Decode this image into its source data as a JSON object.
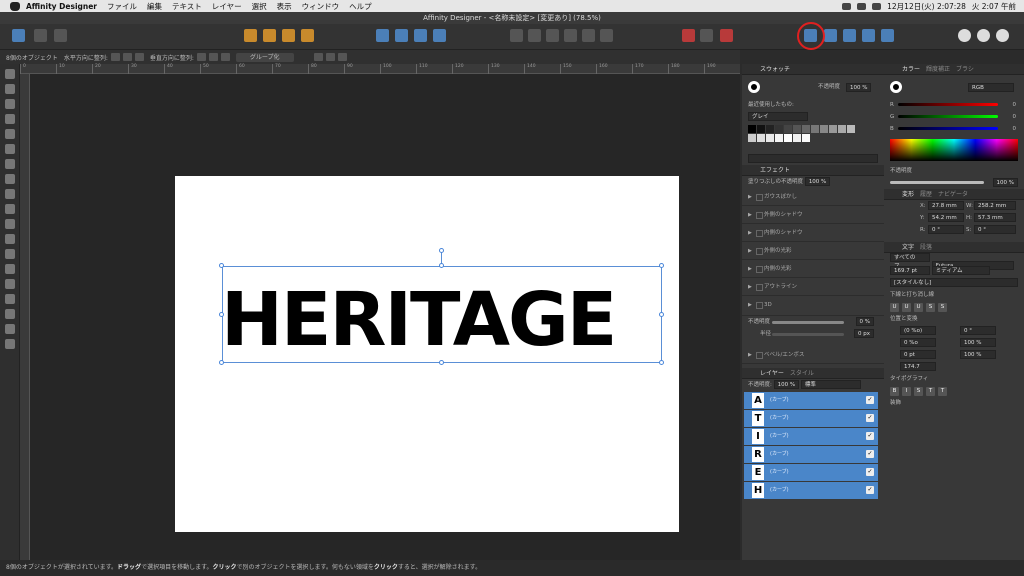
{
  "menubar": {
    "app": "Affinity Designer",
    "items": [
      "ファイル",
      "編集",
      "テキスト",
      "レイヤー",
      "選択",
      "表示",
      "ウィンドウ",
      "ヘルプ"
    ],
    "datetime": "12月12日(火) 2:07:28",
    "user_time": "火 2:07 午前"
  },
  "window": {
    "title": "Affinity Designer - <名称未設定> [変更あり] (78.5%)"
  },
  "context": {
    "selection": "8個のオブジェクト",
    "halign": "水平方向に整列:",
    "valign": "垂直方向に整列:",
    "group": "グループ化"
  },
  "ruler": [
    "0",
    "10",
    "20",
    "30",
    "40",
    "50",
    "60",
    "70",
    "80",
    "90",
    "100",
    "110",
    "120",
    "130",
    "140",
    "150",
    "160",
    "170",
    "180",
    "190"
  ],
  "canvas": {
    "logo_text": "HERITAGE"
  },
  "swatches": {
    "tab": "スウォッチ",
    "opacity_label": "不透明度",
    "opacity": "100 %",
    "recent": "最近使用したもの:",
    "palette": "グレイ"
  },
  "effects": {
    "tab": "エフェクト",
    "fill_opacity_label": "塗りつぶしの不透明度",
    "fill_opacity": "100 %",
    "items": [
      "ガウスぼかし",
      "外側のシャドウ",
      "内側のシャドウ",
      "外側の光彩",
      "内側の光彩",
      "アウトライン",
      "3D"
    ],
    "bevel": "ベベル/エンボス",
    "opacity_label": "不透明度",
    "opacity_value": "0 %",
    "radius_label": "半径",
    "radius_value": "0 px"
  },
  "layers": {
    "tab": "レイヤー",
    "tab2": "スタイル",
    "opacity_label": "不透明度:",
    "opacity": "100 %",
    "blend": "標準",
    "items": [
      {
        "letter": "A",
        "label": "(カーブ)"
      },
      {
        "letter": "T",
        "label": "(カーブ)"
      },
      {
        "letter": "I",
        "label": "(カーブ)"
      },
      {
        "letter": "R",
        "label": "(カーブ)"
      },
      {
        "letter": "E",
        "label": "(カーブ)"
      },
      {
        "letter": "H",
        "label": "(カーブ)"
      }
    ]
  },
  "color": {
    "tabs": [
      "カラー",
      "輝度補正",
      "ブラシ"
    ],
    "mode": "RGB",
    "r": "0",
    "g": "0",
    "b": "0",
    "opacity_label": "不透明度",
    "opacity": "100 %"
  },
  "transform": {
    "tabs": [
      "変形",
      "履歴",
      "ナビゲータ"
    ],
    "x": "27.8 mm",
    "y": "54.2 mm",
    "w": "258.2 mm",
    "h": "57.3 mm",
    "r": "0 °",
    "s": "0 °"
  },
  "text": {
    "tabs": [
      "文字",
      "段落"
    ],
    "family_scope": "すべてのフ...",
    "font": "Futura",
    "size": "169.7 pt",
    "weight": "ミディアム",
    "style": "[スタイルなし]",
    "underline": "下線と打ち消し線",
    "position": "位置と変換",
    "pct1": "(0 %o)",
    "pct2": "0 %o",
    "pt": "0 pt",
    "baseline": "174.7",
    "angle": "0 °",
    "scale1": "100 %",
    "scale2": "100 %",
    "typography": "タイポグラフィ",
    "decor": "装飾"
  },
  "status": {
    "pre": "8個のオブジェクトが選択されています。",
    "drag": "ドラッグ",
    "t1": "で選択項目を移動します。",
    "click": "クリック",
    "t2": "で別のオブジェクトを選択します。何もない領域を",
    "click2": "クリック",
    "t3": "すると、選択が解除されます。"
  }
}
